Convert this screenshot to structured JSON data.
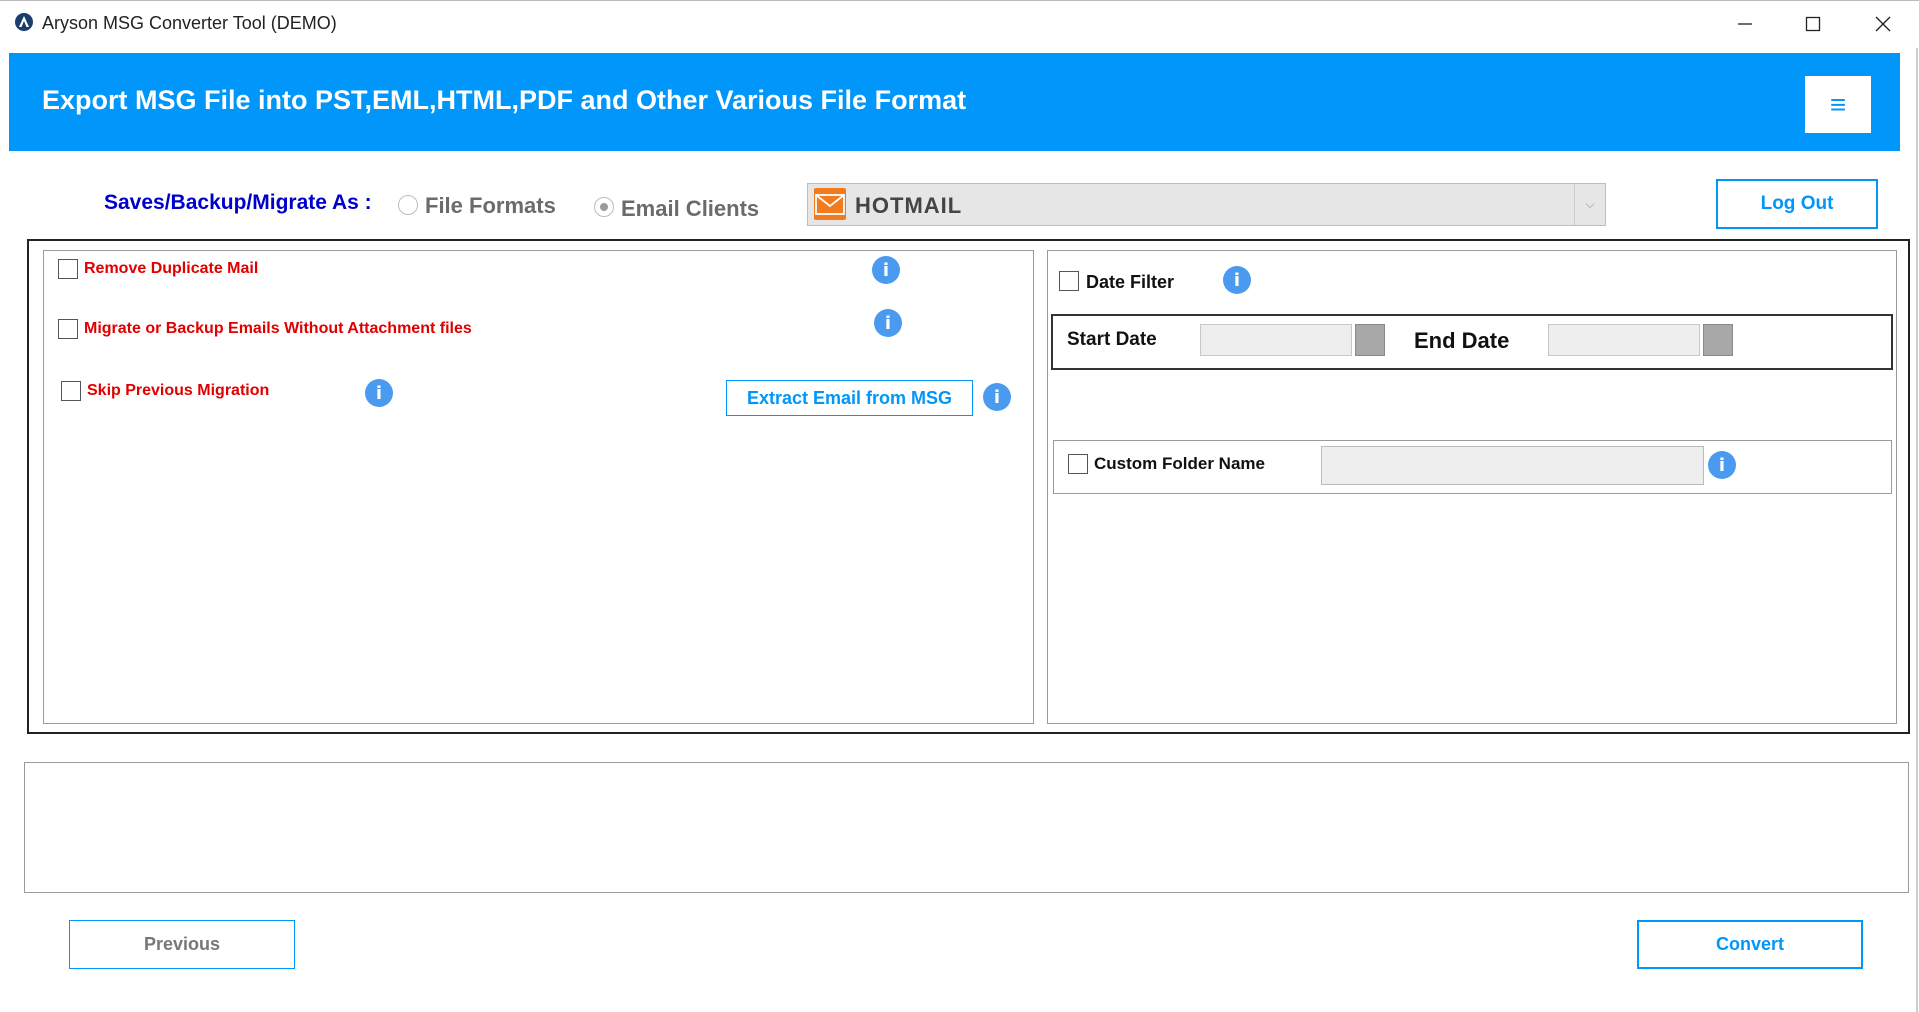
{
  "window": {
    "title": "Aryson MSG Converter Tool (DEMO)",
    "minimize_icon": "minimize-icon",
    "maximize_icon": "maximize-icon",
    "close_icon": "close-icon"
  },
  "banner": {
    "title": "Export MSG File into PST,EML,HTML,PDF and Other Various File Format",
    "menu_glyph": "≡"
  },
  "save_as": {
    "label": "Saves/Backup/Migrate As :",
    "options": [
      {
        "label": "File Formats",
        "checked": false
      },
      {
        "label": "Email Clients",
        "checked": true
      }
    ],
    "selected_client": "HOTMAIL",
    "dropdown_arrow": "⌵",
    "logout_label": "Log Out"
  },
  "left_options": {
    "remove_duplicate": "Remove Duplicate Mail",
    "without_attachment": "Migrate or Backup Emails Without Attachment files",
    "skip_previous": "Skip Previous Migration",
    "extract_button": "Extract Email from MSG",
    "info_glyph": "i"
  },
  "right_options": {
    "date_filter": "Date Filter",
    "start_date_label": "Start Date",
    "end_date_label": "End Date",
    "custom_folder": "Custom Folder Name"
  },
  "footer": {
    "previous_label": "Previous",
    "convert_label": "Convert"
  },
  "colors": {
    "accent": "#0096fa",
    "option_red": "#e00000",
    "label_blue": "#0000cc",
    "info_blue": "#4a9bf0"
  }
}
